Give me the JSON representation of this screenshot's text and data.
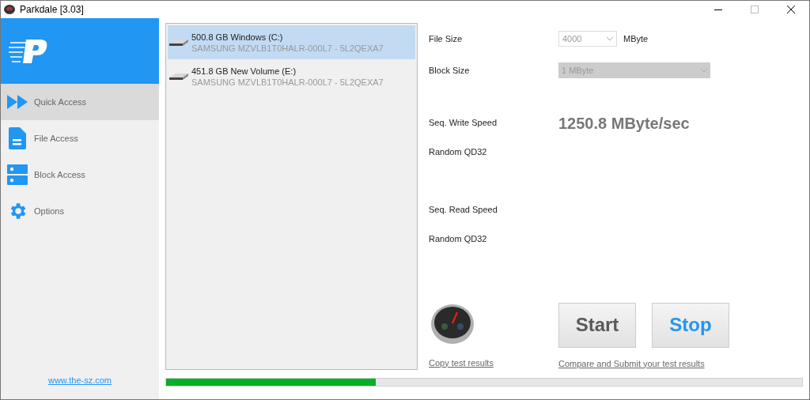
{
  "window": {
    "title": "Parkdale [3.03]"
  },
  "sidebar": {
    "items": [
      {
        "label": "Quick Access",
        "kind": "quick",
        "selected": true
      },
      {
        "label": "File Access",
        "kind": "file",
        "selected": false
      },
      {
        "label": "Block Access",
        "kind": "block",
        "selected": false
      },
      {
        "label": "Options",
        "kind": "options",
        "selected": false
      }
    ],
    "link": "www.the-sz.com"
  },
  "drives": [
    {
      "name": "500.8 GB Windows (C:)",
      "model": "SAMSUNG MZVLB1T0HALR-000L7 - 5L2QEXA7",
      "selected": true
    },
    {
      "name": "451.8 GB New Volume (E:)",
      "model": "SAMSUNG MZVLB1T0HALR-000L7 - 5L2QEXA7",
      "selected": false
    }
  ],
  "settings": [
    {
      "label": "File Size",
      "value": "4000",
      "unit": "MByte",
      "disabled": false
    },
    {
      "label": "Block Size",
      "value": "1 MByte",
      "disabled": true
    }
  ],
  "results": [
    {
      "label": "Seq. Write Speed",
      "value": "1250.8 MByte/sec"
    },
    {
      "label": "Random QD32"
    },
    {
      "label": "Seq. Read Speed"
    },
    {
      "label": "Random QD32"
    }
  ],
  "buttons": [
    {
      "label": "Start",
      "kind": "start"
    },
    {
      "label": "Stop",
      "kind": "stop"
    }
  ],
  "links": [
    "Copy test results",
    "Compare and Submit your test results"
  ],
  "progress": {
    "level": 0.33
  }
}
